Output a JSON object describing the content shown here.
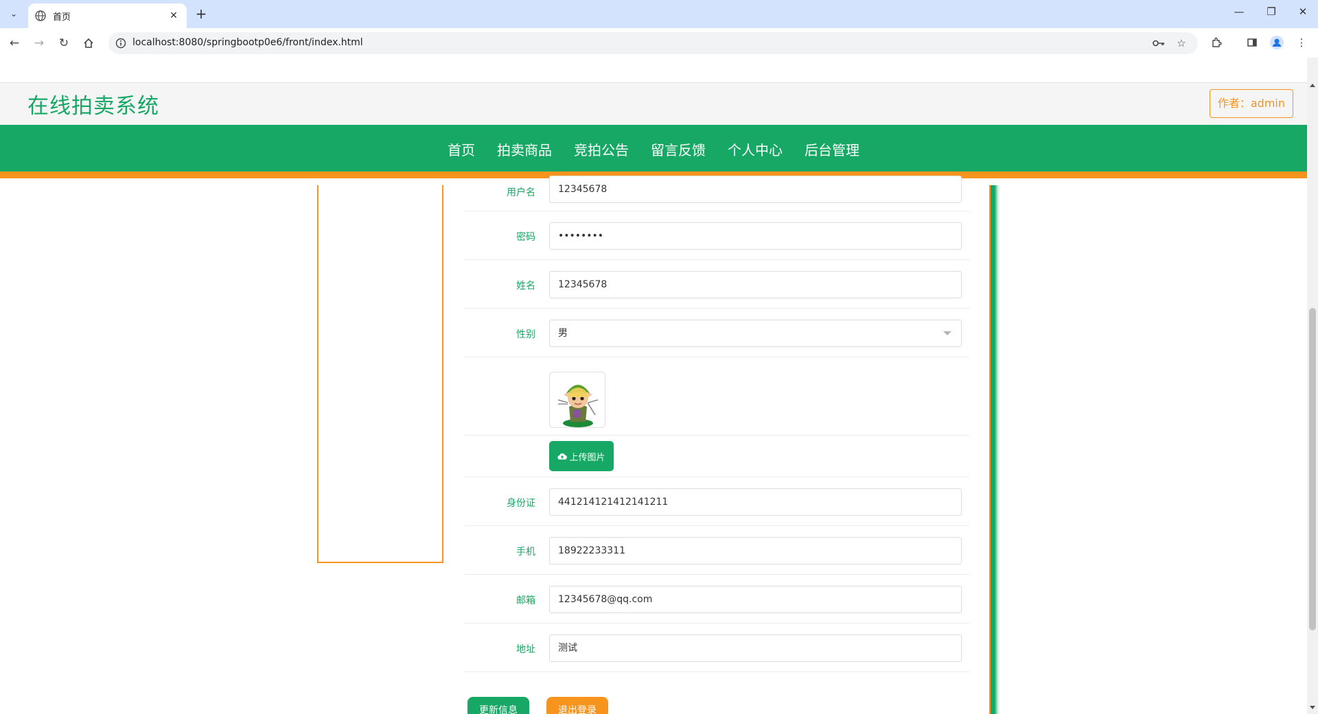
{
  "browser": {
    "tab_title": "首页",
    "url": "localhost:8080/springbootp0e6/front/index.html"
  },
  "site": {
    "title": "在线拍卖系统",
    "author_label": "作者：",
    "author_name": "admin"
  },
  "nav": {
    "items": [
      "首页",
      "拍卖商品",
      "竞拍公告",
      "留言反馈",
      "个人中心",
      "后台管理"
    ]
  },
  "form": {
    "username": {
      "label": "用户名",
      "value": "12345678"
    },
    "password": {
      "label": "密码",
      "value": "••••••••"
    },
    "name": {
      "label": "姓名",
      "value": "12345678"
    },
    "gender": {
      "label": "性别",
      "value": "男"
    },
    "upload_label": "上传图片",
    "id_card": {
      "label": "身份证",
      "value": "441214121412141211"
    },
    "phone": {
      "label": "手机",
      "value": "18922233311"
    },
    "email": {
      "label": "邮箱",
      "value": "12345678@qq.com"
    },
    "address": {
      "label": "地址",
      "value": "测试"
    },
    "update_button": "更新信息",
    "logout_button": "退出登录"
  },
  "colors": {
    "primary": "#16a864",
    "accent": "#f7941e"
  }
}
